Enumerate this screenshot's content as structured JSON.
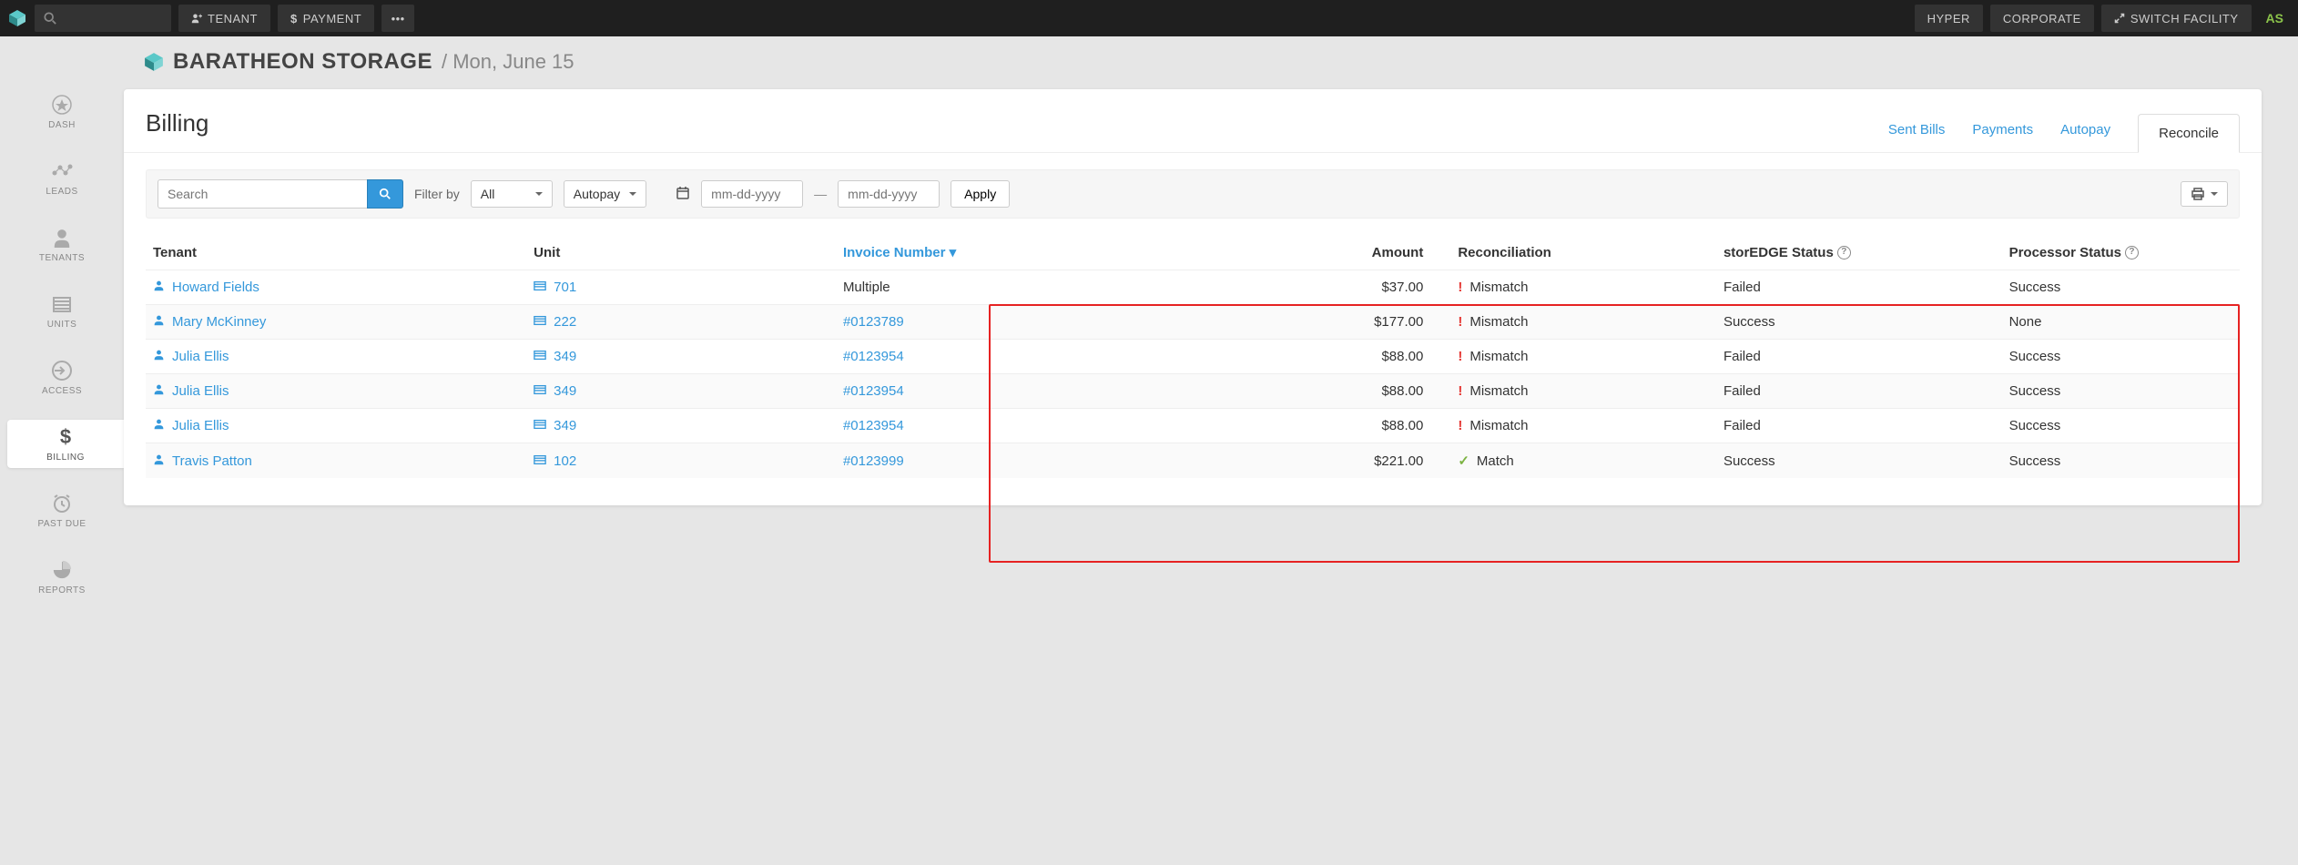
{
  "topbar": {
    "tenant_label": "TENANT",
    "payment_label": "PAYMENT",
    "hyper": "HYPER",
    "corporate": "CORPORATE",
    "switch": "SWITCH FACILITY",
    "avatar": "AS"
  },
  "sidebar": {
    "items": [
      {
        "label": "DASH"
      },
      {
        "label": "LEADS"
      },
      {
        "label": "TENANTS"
      },
      {
        "label": "UNITS"
      },
      {
        "label": "ACCESS"
      },
      {
        "label": "BILLING"
      },
      {
        "label": "PAST DUE"
      },
      {
        "label": "REPORTS"
      }
    ]
  },
  "header": {
    "facility": "BARATHEON STORAGE",
    "date": "Mon, June 15"
  },
  "billing": {
    "title": "Billing",
    "tabs": {
      "sent_bills": "Sent Bills",
      "payments": "Payments",
      "autopay": "Autopay",
      "reconcile": "Reconcile"
    },
    "filter": {
      "search_placeholder": "Search",
      "filter_by_label": "Filter by",
      "filter_all": "All",
      "autopay_label": "Autopay",
      "date_placeholder": "mm-dd-yyyy",
      "apply": "Apply"
    },
    "columns": {
      "tenant": "Tenant",
      "unit": "Unit",
      "invoice": "Invoice Number",
      "amount": "Amount",
      "reconciliation": "Reconciliation",
      "se_status": "storEDGE Status",
      "proc_status": "Processor Status"
    },
    "rows": [
      {
        "tenant": "Howard Fields",
        "unit": "701",
        "invoice": "Multiple",
        "invoice_link": false,
        "amount": "$37.00",
        "recon": "Mismatch",
        "recon_match": false,
        "se": "Failed",
        "proc": "Success"
      },
      {
        "tenant": "Mary McKinney",
        "unit": "222",
        "invoice": "#0123789",
        "invoice_link": true,
        "amount": "$177.00",
        "recon": "Mismatch",
        "recon_match": false,
        "se": "Success",
        "proc": "None"
      },
      {
        "tenant": "Julia Ellis",
        "unit": "349",
        "invoice": "#0123954",
        "invoice_link": true,
        "amount": "$88.00",
        "recon": "Mismatch",
        "recon_match": false,
        "se": "Failed",
        "proc": "Success"
      },
      {
        "tenant": "Julia Ellis",
        "unit": "349",
        "invoice": "#0123954",
        "invoice_link": true,
        "amount": "$88.00",
        "recon": "Mismatch",
        "recon_match": false,
        "se": "Failed",
        "proc": "Success"
      },
      {
        "tenant": "Julia Ellis",
        "unit": "349",
        "invoice": "#0123954",
        "invoice_link": true,
        "amount": "$88.00",
        "recon": "Mismatch",
        "recon_match": false,
        "se": "Failed",
        "proc": "Success"
      },
      {
        "tenant": "Travis Patton",
        "unit": "102",
        "invoice": "#0123999",
        "invoice_link": true,
        "amount": "$221.00",
        "recon": "Match",
        "recon_match": true,
        "se": "Success",
        "proc": "Success"
      }
    ]
  }
}
